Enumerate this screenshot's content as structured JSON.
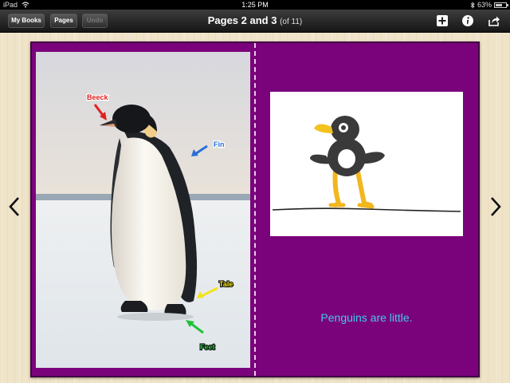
{
  "status_bar": {
    "device": "iPad",
    "time": "1:25 PM",
    "battery_text": "63%",
    "battery_level": 0.63
  },
  "toolbar": {
    "my_books_label": "My Books",
    "pages_label": "Pages",
    "undo_label": "Undo",
    "title": "Pages 2 and 3",
    "title_sub": "(of 11)",
    "icons": [
      "plus-icon",
      "info-icon",
      "share-icon"
    ]
  },
  "book": {
    "background_color": "#7a037b",
    "left_page": {
      "labels": {
        "beak": "Beeck",
        "fin": "Fin",
        "tail": "Tale",
        "feet": "Feet"
      },
      "label_colors": {
        "beak": "#e02020",
        "fin": "#2a6fd6",
        "tail": "#f4e21a",
        "feet": "#22c23a"
      }
    },
    "right_page": {
      "caption": "Penguins are little.",
      "caption_color": "#44c8f0"
    }
  },
  "navigation": {
    "prev_icon": "chevron-left-icon",
    "next_icon": "chevron-right-icon"
  }
}
